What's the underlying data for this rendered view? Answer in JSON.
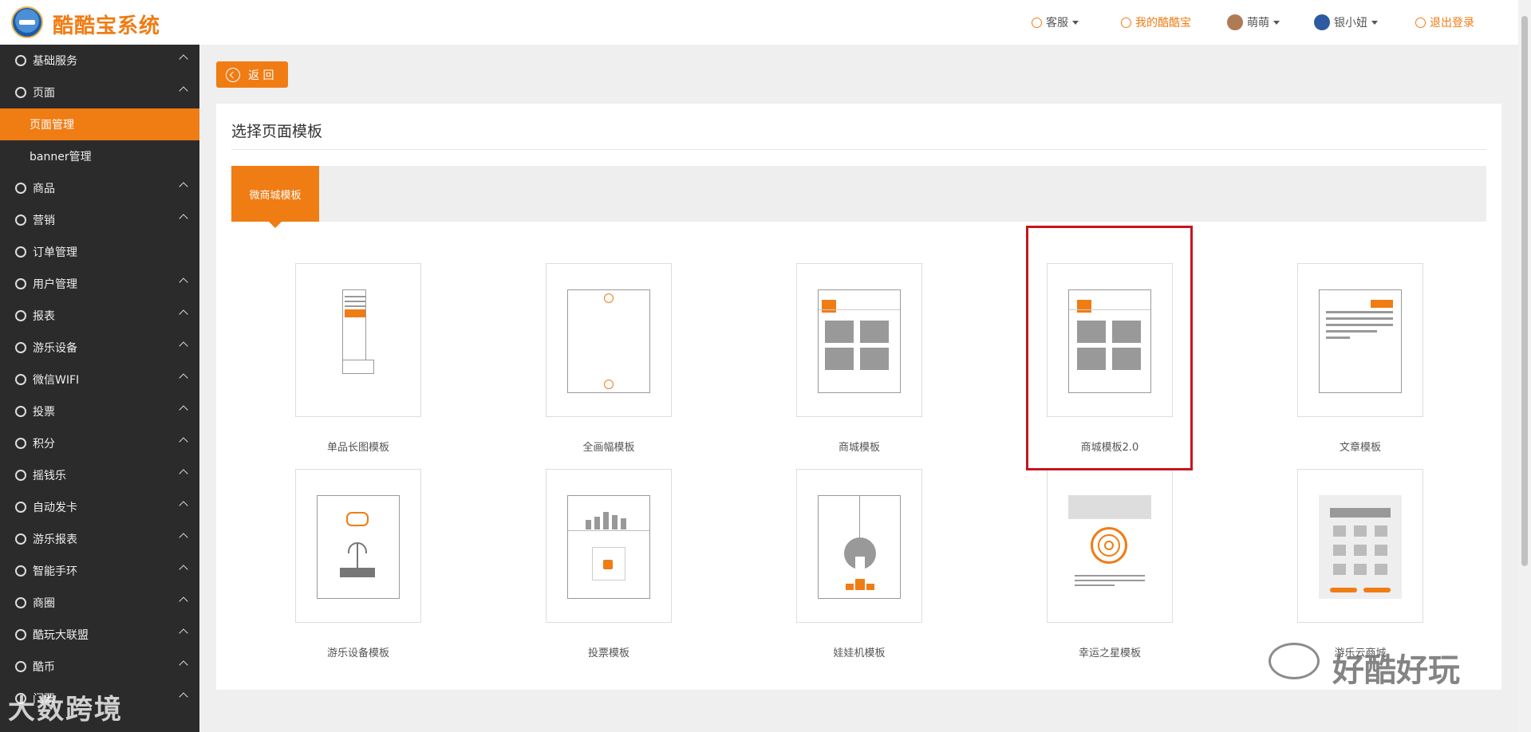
{
  "app": {
    "title": "酷酷宝系统"
  },
  "header": {
    "service": "客服",
    "my_account": "我的酷酷宝",
    "user1": "萌萌",
    "user2": "银小妞",
    "logout": "退出登录"
  },
  "sidebar": {
    "items": [
      {
        "label": "基础服务"
      },
      {
        "label": "页面"
      },
      {
        "label": "页面管理"
      },
      {
        "label": "banner管理"
      },
      {
        "label": "商品"
      },
      {
        "label": "营销"
      },
      {
        "label": "订单管理"
      },
      {
        "label": "用户管理"
      },
      {
        "label": "报表"
      },
      {
        "label": "游乐设备"
      },
      {
        "label": "微信WIFI"
      },
      {
        "label": "投票"
      },
      {
        "label": "积分"
      },
      {
        "label": "摇钱乐"
      },
      {
        "label": "自动发卡"
      },
      {
        "label": "游乐报表"
      },
      {
        "label": "智能手环"
      },
      {
        "label": "商圈"
      },
      {
        "label": "酷玩大联盟"
      },
      {
        "label": "酷币"
      },
      {
        "label": "门票"
      }
    ]
  },
  "back_button": {
    "label": "返 回"
  },
  "panel": {
    "title": "选择页面模板",
    "tab": "微商城模板"
  },
  "templates": [
    {
      "label": "单品长图模板",
      "icon": "single-long-image-icon"
    },
    {
      "label": "全画幅模板",
      "icon": "full-frame-icon"
    },
    {
      "label": "商城模板",
      "icon": "mall-grid-icon"
    },
    {
      "label": "商城模板2.0",
      "icon": "mall-grid-icon"
    },
    {
      "label": "文章模板",
      "icon": "article-icon"
    },
    {
      "label": "游乐设备模板",
      "icon": "gamepad-router-icon"
    },
    {
      "label": "投票模板",
      "icon": "vote-thumbs-up-icon"
    },
    {
      "label": "娃娃机模板",
      "icon": "claw-machine-icon"
    },
    {
      "label": "幸运之星模板",
      "icon": "fingerprint-icon"
    },
    {
      "label": "游乐云商城",
      "icon": "calculator-grid-icon"
    }
  ],
  "watermarks": {
    "left": "大数跨境",
    "right": "好酷好玩"
  },
  "colors": {
    "accent": "#f07c14",
    "sidebar_bg": "#2b2b2b",
    "highlight": "#c8151d"
  }
}
